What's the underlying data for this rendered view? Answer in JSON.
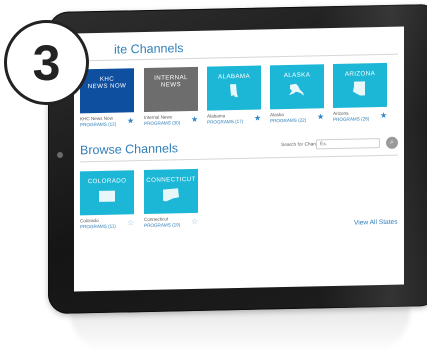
{
  "step_badge": "3",
  "favorites": {
    "title": "Favorite Channels",
    "title_visible": "ite Channels",
    "tiles": [
      {
        "name": "NEWS NOW",
        "name_line1": "KHC",
        "caption": "KHC News Now",
        "programs": "PROGRAMS (12)",
        "style": "blue",
        "starred": true
      },
      {
        "name": "INTERNAL NEWS",
        "name_line1": "INTERNAL",
        "name_line2": "NEWS",
        "caption": "Internal News",
        "programs": "PROGRAMS (30)",
        "style": "gray",
        "starred": true
      },
      {
        "name": "ALABAMA",
        "caption": "Alabama",
        "programs": "PROGRAMS (17)",
        "style": "cyan",
        "starred": true
      },
      {
        "name": "ALASKA",
        "caption": "Alaska",
        "programs": "PROGRAMS (22)",
        "style": "cyan",
        "starred": true
      },
      {
        "name": "ARIZONA",
        "caption": "Arizona",
        "programs": "PROGRAMS (28)",
        "style": "cyan",
        "starred": true
      }
    ]
  },
  "browse": {
    "title": "Browse Channels",
    "search_label": "Search for Channels",
    "search_placeholder": "Ex.",
    "tiles": [
      {
        "name": "COLORADO",
        "caption": "Colorado",
        "programs": "PROGRAMS (11)",
        "style": "cyan",
        "starred": false
      },
      {
        "name": "CONNECTICUT",
        "caption": "Connecticut",
        "programs": "PROGRAMS (19)",
        "style": "cyan",
        "starred": false
      }
    ],
    "view_all": "View All States"
  },
  "icons": {
    "star_filled": "star-filled-icon",
    "star_outline": "star-outline-icon",
    "search": "search-icon"
  },
  "colors": {
    "accent": "#2f7fb8",
    "tile_blue": "#0f4fa0",
    "tile_gray": "#6d6d6d",
    "tile_cyan": "#1cb7d6",
    "badge_border": "#222222"
  }
}
